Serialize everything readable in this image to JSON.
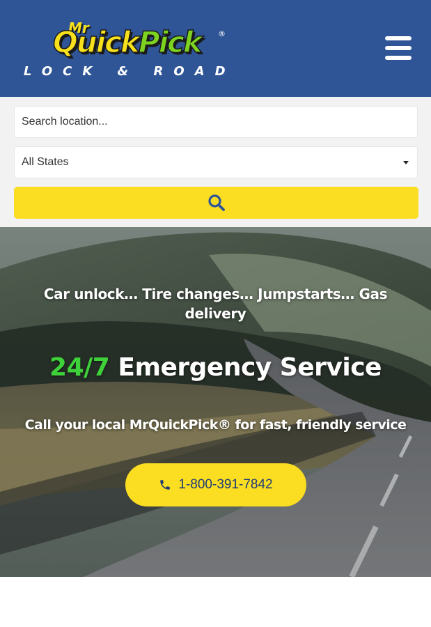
{
  "header": {
    "logo": {
      "prefix": "Mr",
      "word_quick": "Quick",
      "word_pick": "Pick",
      "registered": "®",
      "tagline": "LOCK & ROAD"
    },
    "menu_icon": "hamburger-menu-icon"
  },
  "search": {
    "placeholder": "Search location...",
    "value": "",
    "state_select": {
      "selected": "All States"
    },
    "button_icon": "search-icon"
  },
  "hero": {
    "services": "Car unlock… Tire changes… Jumpstarts… Gas delivery",
    "title_accent": "24/7",
    "title_rest": " Emergency Service",
    "subtitle": "Call your local MrQuickPick® for fast, friendly service",
    "phone": {
      "icon": "phone-icon",
      "label": "1-800-391-7842"
    }
  },
  "colors": {
    "header_bg": "#2f5597",
    "brand_yellow": "#fbdd22",
    "accent_green": "#3fd13a",
    "search_panel_bg": "#f2f2f2",
    "phone_text": "#1f3b75"
  }
}
